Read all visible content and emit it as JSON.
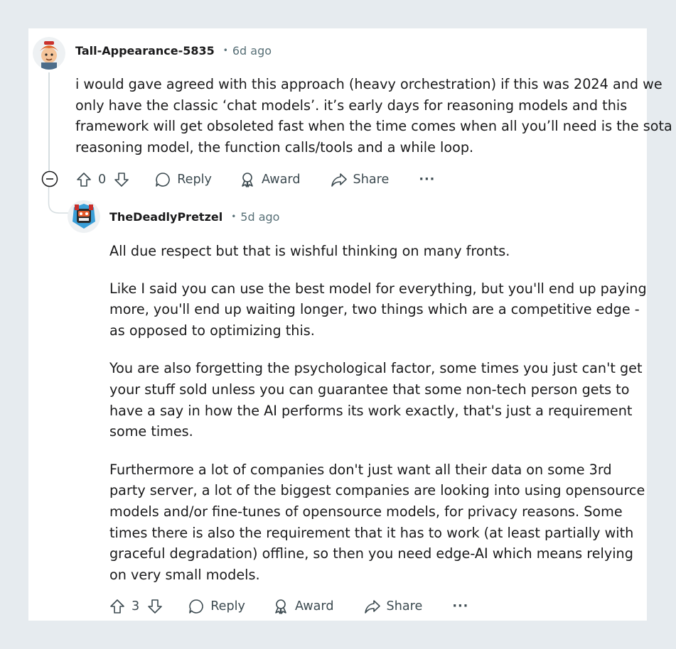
{
  "comment1": {
    "username": "Tall-Appearance-5835",
    "time": "6d ago",
    "body": [
      "i would gave agreed with this approach (heavy orchestration) if this was 2024 and we",
      "only have the classic ‘chat models’. it’s early days for reasoning models and this",
      "framework will get obsoleted fast when the time comes when all you’ll need is the sota",
      "reasoning model, the function calls/tools and a while loop."
    ],
    "votes": "0",
    "reply_label": "Reply",
    "award_label": "Award",
    "share_label": "Share",
    "more_label": "···"
  },
  "comment2": {
    "username": "TheDeadlyPretzel",
    "time": "5d ago",
    "paragraphs": [
      "All due respect but that is wishful thinking on many fronts.",
      "Like I said you can use the best model for everything, but you'll end up paying more, you'll end up waiting longer, two things which are a competitive edge - as opposed to optimizing this.",
      "You are also forgetting the psychological factor, some times you just can't get your stuff sold unless you can guarantee that some non-tech person gets to have a say in how the AI performs its work exactly, that's just a requirement some times.",
      "Furthermore a lot of companies don't just want all their data on some 3rd party server, a lot of the biggest companies are looking into using opensource models and/or fine-tunes of opensource models, for privacy reasons. Some times there is also the requirement that it has to work (at least partially with graceful degradation) offline, so then you need edge-AI which means relying on very small models."
    ],
    "votes": "3",
    "reply_label": "Reply",
    "award_label": "Award",
    "share_label": "Share",
    "more_label": "···"
  },
  "icons": {
    "upvote": "upvote-icon",
    "downvote": "downvote-icon",
    "reply": "comment-bubble-icon",
    "award": "award-icon",
    "share": "share-arrow-icon",
    "collapse": "collapse-minus-icon"
  },
  "colors": {
    "background": "#e6ebef",
    "card": "#ffffff",
    "muted_text": "#576f76",
    "thread_line": "#d5dde0"
  }
}
